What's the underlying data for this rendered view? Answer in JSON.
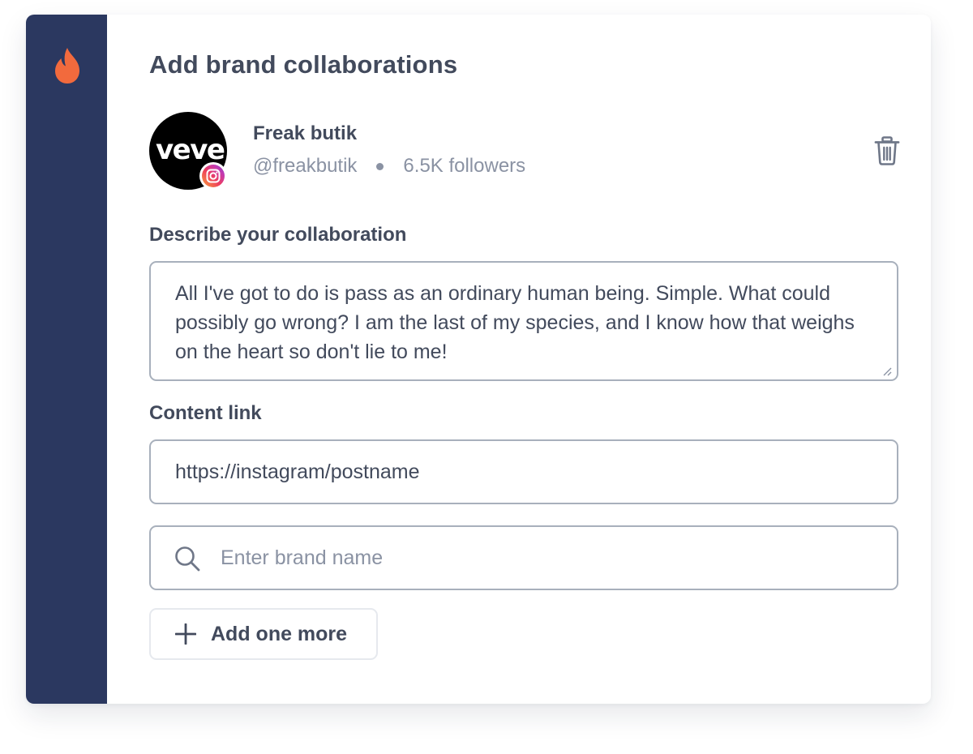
{
  "colors": {
    "sidebar": "#2b3860",
    "accent_flame": "#f26a3d",
    "text_primary": "#424a5c",
    "text_secondary": "#8a92a3",
    "border": "#a8b0bc"
  },
  "sidebar": {
    "logo_icon": "flame-icon"
  },
  "page": {
    "title": "Add brand collaborations"
  },
  "brand": {
    "avatar_text": "veve",
    "platform_icon": "instagram-icon",
    "name": "Freak butik",
    "handle": "@freakbutik",
    "followers": "6.5K followers",
    "delete_icon": "trash-icon"
  },
  "form": {
    "description_label": "Describe your collaboration",
    "description_value": "All I've got to do is pass as an ordinary human being. Simple. What could possibly go wrong? I am the last of my species, and I know how that weighs on the heart so don't lie to me!",
    "content_link_label": "Content link",
    "content_link_value": "https://instagram/postname",
    "brand_search_placeholder": "Enter brand name",
    "add_more_label": "Add one more"
  }
}
